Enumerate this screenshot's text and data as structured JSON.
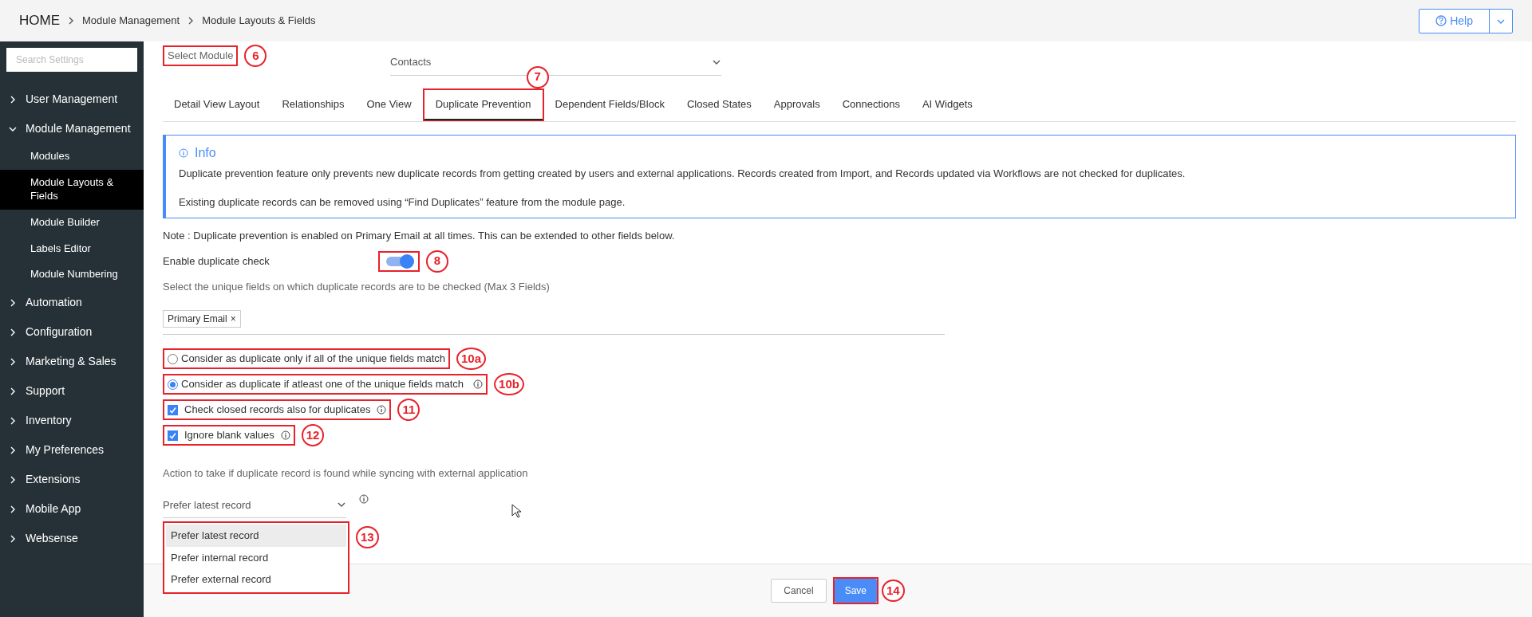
{
  "breadcrumb": {
    "home": "HOME",
    "items": [
      "Module Management",
      "Module Layouts & Fields"
    ]
  },
  "help": {
    "label": "Help"
  },
  "sidebar": {
    "search_placeholder": "Search Settings",
    "items": [
      {
        "label": "User Management",
        "expanded": false
      },
      {
        "label": "Module Management",
        "expanded": true,
        "children": [
          {
            "label": "Modules",
            "selected": false
          },
          {
            "label": "Module Layouts & Fields",
            "selected": true
          },
          {
            "label": "Module Builder",
            "selected": false
          },
          {
            "label": "Labels Editor",
            "selected": false
          },
          {
            "label": "Module Numbering",
            "selected": false
          }
        ]
      },
      {
        "label": "Automation",
        "expanded": false
      },
      {
        "label": "Configuration",
        "expanded": false
      },
      {
        "label": "Marketing & Sales",
        "expanded": false
      },
      {
        "label": "Support",
        "expanded": false
      },
      {
        "label": "Inventory",
        "expanded": false
      },
      {
        "label": "My Preferences",
        "expanded": false
      },
      {
        "label": "Extensions",
        "expanded": false
      },
      {
        "label": "Mobile App",
        "expanded": false
      },
      {
        "label": "Websense",
        "expanded": false
      }
    ]
  },
  "module_select": {
    "label": "Select Module",
    "value": "Contacts",
    "callout": "6"
  },
  "tabs": [
    {
      "label": "Detail View Layout",
      "selected": false
    },
    {
      "label": "Relationships",
      "selected": false
    },
    {
      "label": "One View",
      "selected": false
    },
    {
      "label": "Duplicate Prevention",
      "selected": true,
      "callout": "7"
    },
    {
      "label": "Dependent Fields/Block",
      "selected": false
    },
    {
      "label": "Closed States",
      "selected": false
    },
    {
      "label": "Approvals",
      "selected": false
    },
    {
      "label": "Connections",
      "selected": false
    },
    {
      "label": "AI Widgets",
      "selected": false
    }
  ],
  "info": {
    "title": "Info",
    "paragraphs": [
      "Duplicate prevention feature only prevents new duplicate records from getting created by users and external applications. Records created from Import, and Records updated via Workflows are not checked for duplicates.",
      "Existing duplicate records can be removed using “Find Duplicates” feature from the module page."
    ]
  },
  "note": "Note : Duplicate prevention is enabled on Primary Email at all times. This can be extended to other fields below.",
  "duplicate_check": {
    "label": "Enable duplicate check",
    "on": true,
    "callout": "8"
  },
  "unique_fields": {
    "label": "Select the unique fields on which duplicate records are to be checked (Max 3 Fields)",
    "tags": [
      {
        "label": "Primary Email",
        "remove": "×"
      }
    ]
  },
  "match_options": [
    {
      "label": "Consider as duplicate only if all of the unique fields match",
      "selected": false,
      "info": false,
      "callout": "10a"
    },
    {
      "label": "Consider as duplicate if atleast one of the unique fields match",
      "selected": true,
      "info": true,
      "callout": "10b"
    }
  ],
  "checks": [
    {
      "label": "Check closed records also for duplicates",
      "checked": true,
      "info": true,
      "callout": "11"
    },
    {
      "label": "Ignore blank values",
      "checked": true,
      "info": true,
      "callout": "12"
    }
  ],
  "sync_action": {
    "label": "Action to take if duplicate record is found while syncing with external application",
    "value": "Prefer latest record",
    "callout": "13",
    "options": [
      {
        "label": "Prefer latest record",
        "selected": true
      },
      {
        "label": "Prefer internal record",
        "selected": false
      },
      {
        "label": "Prefer external record",
        "selected": false
      }
    ]
  },
  "buttons": [
    {
      "label": "Cancel",
      "kind": "secondary"
    },
    {
      "label": "Save",
      "kind": "primary",
      "callout": "14"
    }
  ]
}
